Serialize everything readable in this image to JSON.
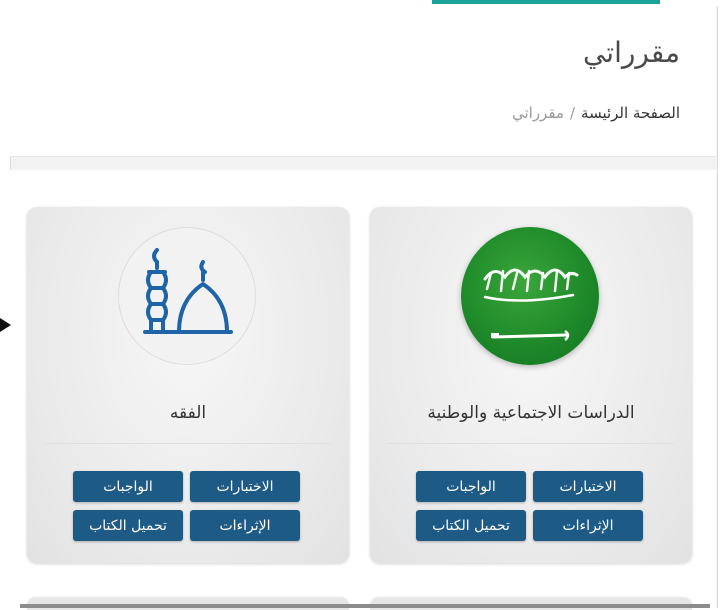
{
  "header": {
    "title": "مقرراتي",
    "breadcrumb": {
      "home": "الصفحة الرئيسة",
      "separator": "/",
      "current": "مقرراتي"
    }
  },
  "courses": [
    {
      "title": "الدراسات الاجتماعية والوطنية",
      "image_icon": "saudi-flag-icon",
      "buttons": {
        "tests": "الاختبارات",
        "assignments": "الواجبات",
        "enrichments": "الإثراءات",
        "download_book": "تحميل الكتاب"
      }
    },
    {
      "title": "الفقه",
      "image_icon": "mosque-icon",
      "buttons": {
        "tests": "الاختبارات",
        "assignments": "الواجبات",
        "enrichments": "الإثراءات",
        "download_book": "تحميل الكتاب"
      }
    }
  ],
  "colors": {
    "button": "#1e5a86",
    "accent": "#1aa39a",
    "flag_green": "#1f8a2a",
    "mosque_blue": "#1f63a8"
  }
}
